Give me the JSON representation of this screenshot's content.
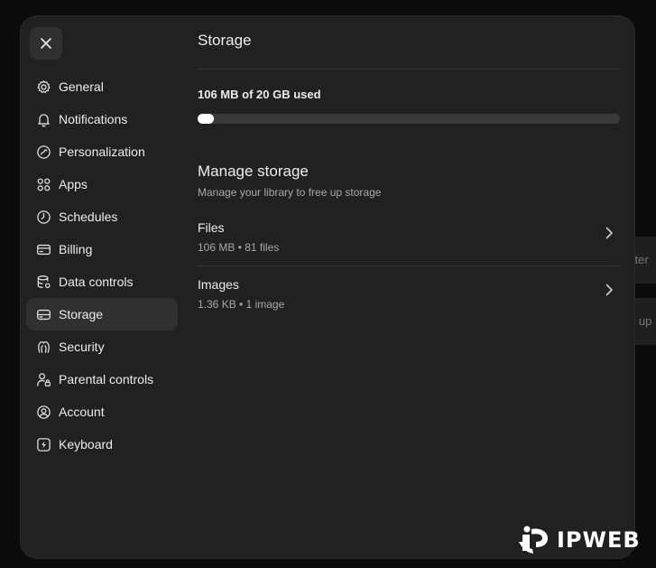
{
  "sidebar": {
    "items": [
      {
        "label": "General",
        "icon": "gear-icon"
      },
      {
        "label": "Notifications",
        "icon": "bell-icon"
      },
      {
        "label": "Personalization",
        "icon": "personalization-icon"
      },
      {
        "label": "Apps",
        "icon": "apps-grid-icon"
      },
      {
        "label": "Schedules",
        "icon": "clock-icon"
      },
      {
        "label": "Billing",
        "icon": "credit-card-icon"
      },
      {
        "label": "Data controls",
        "icon": "database-gear-icon"
      },
      {
        "label": "Storage",
        "icon": "storage-drive-icon",
        "active": true
      },
      {
        "label": "Security",
        "icon": "security-icon"
      },
      {
        "label": "Parental controls",
        "icon": "parental-lock-icon"
      },
      {
        "label": "Account",
        "icon": "user-circle-icon"
      },
      {
        "label": "Keyboard",
        "icon": "keyboard-bolt-icon"
      }
    ]
  },
  "storage": {
    "title": "Storage",
    "usage_label": "106 MB of 20 GB used",
    "usage_fraction": 0.0053
  },
  "manage": {
    "title": "Manage storage",
    "subtitle": "Manage your library to free up storage",
    "rows": [
      {
        "title": "Files",
        "meta": "106 MB • 81 files"
      },
      {
        "title": "Images",
        "meta": "1.36 KB • 1 image"
      }
    ]
  },
  "background": {
    "snippets": [
      "xter",
      "g up"
    ]
  },
  "watermark": {
    "text": "IPWEB"
  },
  "colors": {
    "modal_bg": "#212121",
    "active_item_bg": "#303030",
    "progress_fill": "#ffffff",
    "progress_track": "#3a3a3a"
  }
}
